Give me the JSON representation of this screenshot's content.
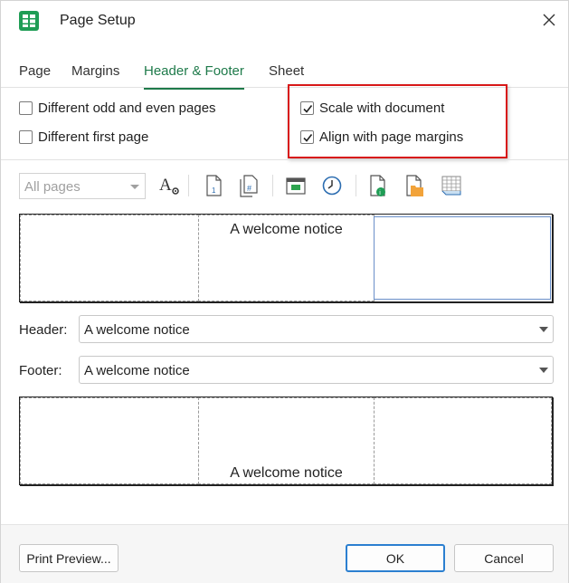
{
  "window": {
    "title": "Page Setup"
  },
  "tabs": [
    {
      "label": "Page"
    },
    {
      "label": "Margins"
    },
    {
      "label": "Header & Footer"
    },
    {
      "label": "Sheet"
    }
  ],
  "options": {
    "odd_even": {
      "label": "Different odd and even pages",
      "checked": false
    },
    "first_page": {
      "label": "Different first page",
      "checked": false
    },
    "scale_with_document": {
      "label": "Scale with document",
      "checked": true
    },
    "align_with_margins": {
      "label": "Align with page margins",
      "checked": true
    }
  },
  "toolbar": {
    "pages_select": {
      "value": "All pages"
    },
    "icons": [
      "font-format-icon",
      "page-number-icon",
      "page-count-icon",
      "date-icon",
      "time-icon",
      "file-path-icon",
      "file-name-icon",
      "sheet-name-icon"
    ]
  },
  "header_preview": {
    "left": "",
    "center": "A welcome notice",
    "right": ""
  },
  "header": {
    "label": "Header:",
    "value": "A welcome notice"
  },
  "footer": {
    "label": "Footer:",
    "value": "A welcome notice"
  },
  "footer_preview": {
    "left": "",
    "center": "A welcome notice",
    "right": ""
  },
  "buttons": {
    "print_preview": "Print Preview...",
    "ok": "OK",
    "cancel": "Cancel"
  },
  "colors": {
    "accent": "#1e7a4a",
    "highlight": "#d81818",
    "primary_border": "#2b7fd0"
  }
}
